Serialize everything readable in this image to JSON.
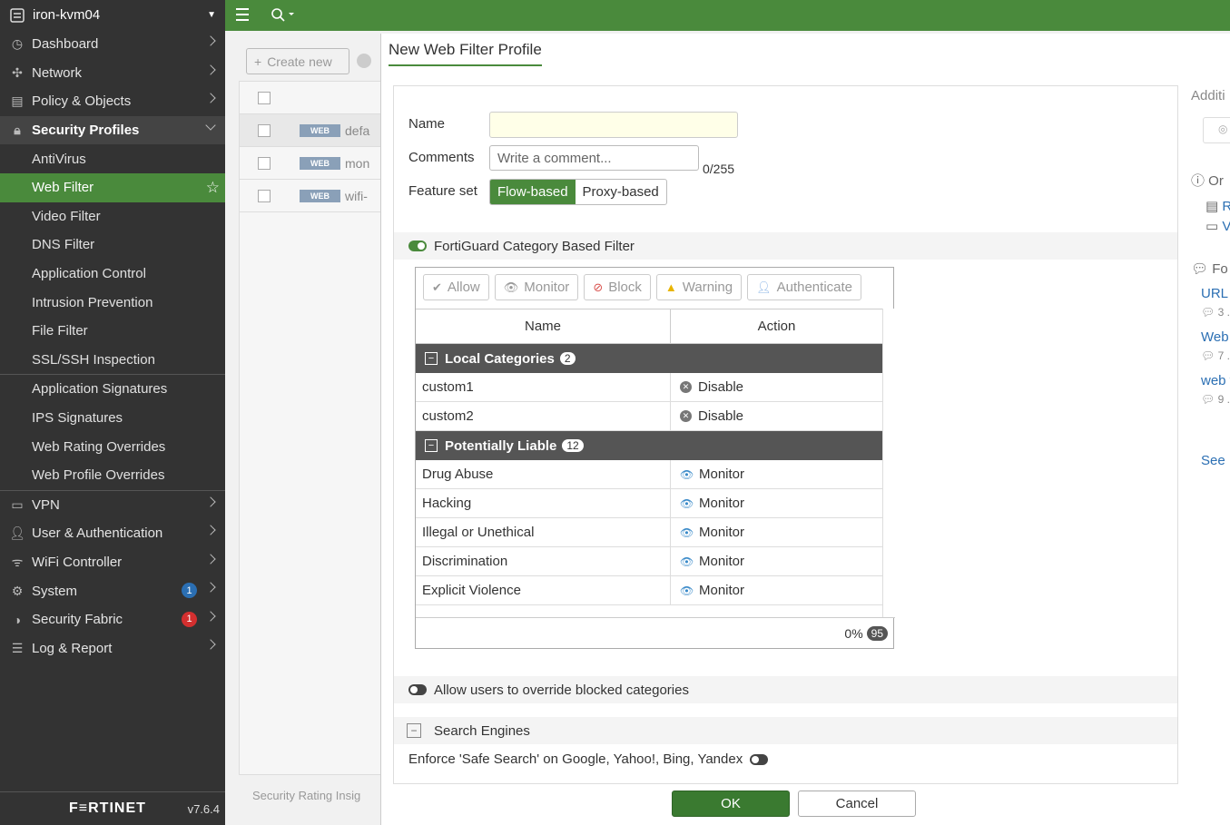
{
  "sidebar": {
    "device": "iron-kvm04",
    "top_items": [
      {
        "label": "Dashboard",
        "icon": "dashboard-icon"
      },
      {
        "label": "Network",
        "icon": "network-icon"
      },
      {
        "label": "Policy & Objects",
        "icon": "policy-icon"
      }
    ],
    "group_label": "Security Profiles",
    "sub_items": [
      "AntiVirus",
      "Web Filter",
      "Video Filter",
      "DNS Filter",
      "Application Control",
      "Intrusion Prevention",
      "File Filter",
      "SSL/SSH Inspection"
    ],
    "sub_items2": [
      "Application Signatures",
      "IPS Signatures",
      "Web Rating Overrides",
      "Web Profile Overrides"
    ],
    "bottom_items": [
      {
        "label": "VPN",
        "badge": ""
      },
      {
        "label": "User & Authentication",
        "badge": ""
      },
      {
        "label": "WiFi Controller",
        "badge": ""
      },
      {
        "label": "System",
        "badge": "1"
      },
      {
        "label": "Security Fabric",
        "badge": "1"
      },
      {
        "label": "Log & Report",
        "badge": ""
      }
    ],
    "logo": "F≡RTINET",
    "version": "v7.6.4"
  },
  "background": {
    "create_new": "Create new",
    "rows": [
      {
        "tag": "WEB",
        "name": "defa"
      },
      {
        "tag": "WEB",
        "name": "mon"
      },
      {
        "tag": "WEB",
        "name": "wifi-"
      }
    ],
    "footer": "Security Rating Insig"
  },
  "modal": {
    "title": "New Web Filter Profile",
    "name_label": "Name",
    "name_value": "",
    "comments_label": "Comments",
    "comments_placeholder": "Write a comment...",
    "comments_counter": "0/255",
    "feature_set_label": "Feature set",
    "feature_options": [
      "Flow-based",
      "Proxy-based"
    ],
    "fortiguard_label": "FortiGuard Category Based Filter",
    "actions": [
      "Allow",
      "Monitor",
      "Block",
      "Warning",
      "Authenticate"
    ],
    "col_name": "Name",
    "col_action": "Action",
    "groups": [
      {
        "label": "Local Categories",
        "count": "2",
        "rows": [
          {
            "name": "custom1",
            "action": "Disable"
          },
          {
            "name": "custom2",
            "action": "Disable"
          }
        ]
      },
      {
        "label": "Potentially Liable",
        "count": "12",
        "rows": [
          {
            "name": "Drug Abuse",
            "action": "Monitor"
          },
          {
            "name": "Hacking",
            "action": "Monitor"
          },
          {
            "name": "Illegal or Unethical",
            "action": "Monitor"
          },
          {
            "name": "Discrimination",
            "action": "Monitor"
          },
          {
            "name": "Explicit Violence",
            "action": "Monitor"
          }
        ]
      }
    ],
    "footer_percent": "0%",
    "footer_count": "95",
    "override_label": "Allow users to override blocked categories",
    "search_engines_label": "Search Engines",
    "safe_search_label": "Enforce 'Safe Search' on Google, Yahoo!, Bing, Yandex",
    "ok": "OK",
    "cancel": "Cancel"
  },
  "right_panel": {
    "title": "Additi",
    "q": "Or",
    "l1": "R",
    "l2": "V",
    "fo": "Fo",
    "links": [
      {
        "text": "URL I",
        "cnt": "3 ."
      },
      {
        "text": "Web",
        "cnt": "7 ."
      },
      {
        "text": "web f",
        "cnt": "9 ."
      }
    ],
    "see_more": "See N"
  },
  "colors": {
    "accent": "#4a8a3c",
    "sidebar": "#333333",
    "badge_blue": "#2b6fb3",
    "badge_red": "#d32f2f"
  }
}
